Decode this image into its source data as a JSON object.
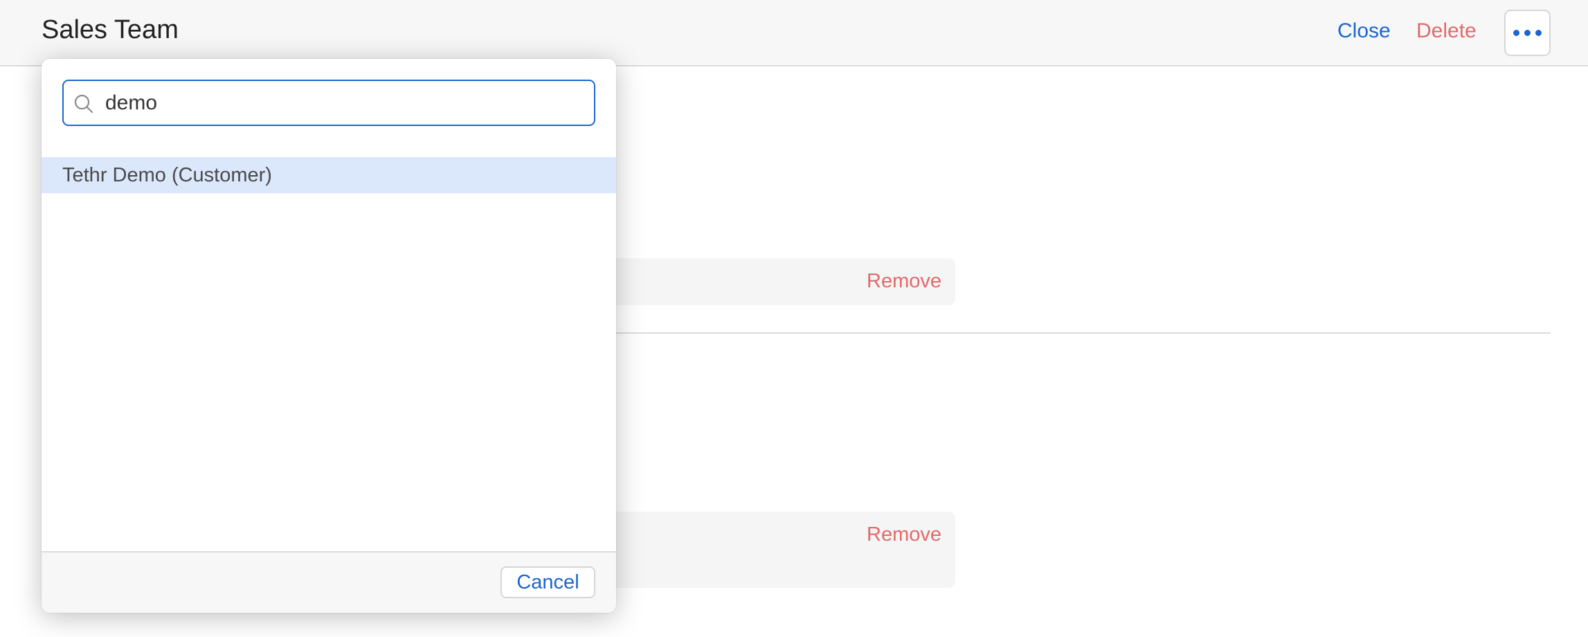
{
  "header": {
    "title": "Sales Team",
    "close_label": "Close",
    "delete_label": "Delete",
    "more_icon": "ellipsis-icon"
  },
  "content": {
    "rows": [
      {
        "remove_label": "Remove"
      },
      {
        "remove_label": "Remove"
      }
    ]
  },
  "picker": {
    "search_icon": "search-icon",
    "search_value": "demo",
    "results": [
      {
        "label": "Tethr Demo (Customer)",
        "highlighted": true
      }
    ],
    "cancel_label": "Cancel"
  },
  "colors": {
    "accent": "#1a66d1",
    "danger": "#e06a6a",
    "highlight": "#dbe7fb"
  }
}
